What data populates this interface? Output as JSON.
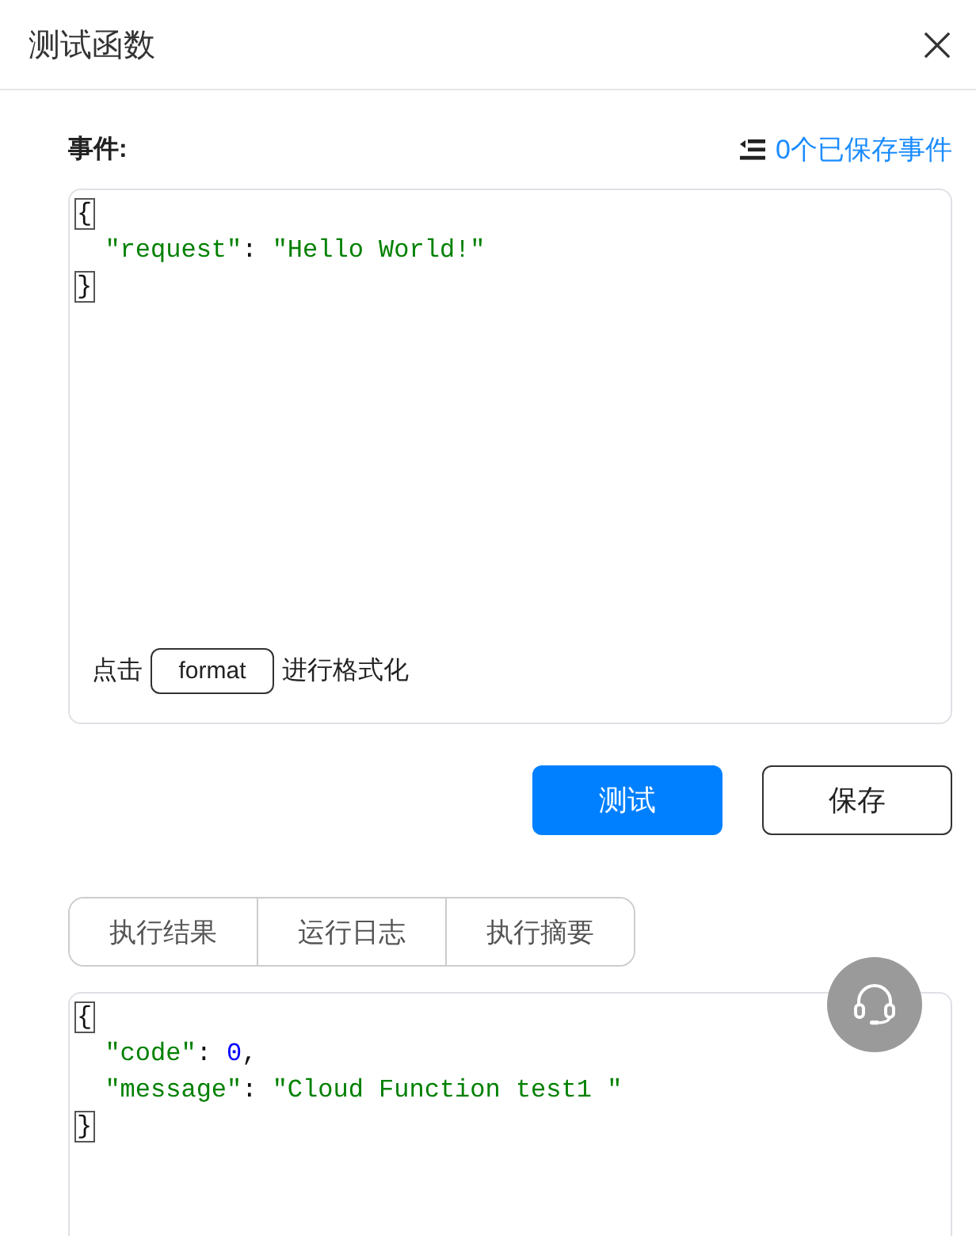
{
  "dialog": {
    "title": "测试函数"
  },
  "event": {
    "label": "事件:",
    "saved_events_link": "0个已保存事件",
    "lines": [
      {
        "tokens": [
          {
            "kind": "bracket",
            "text": "{"
          }
        ],
        "children": [
          {
            "tokens": [
              {
                "kind": "string",
                "text": "\"request\""
              },
              {
                "kind": "punct",
                "text": ": "
              },
              {
                "kind": "string",
                "text": "\"Hello World!\""
              }
            ]
          }
        ]
      },
      {
        "tokens": [
          {
            "kind": "bracket",
            "text": "}"
          }
        ]
      }
    ],
    "format_hint": {
      "before": "点击",
      "button": "format",
      "after": "进行格式化"
    }
  },
  "actions": [
    {
      "label": "测试",
      "kind": "primary"
    },
    {
      "label": "保存",
      "kind": "default"
    }
  ],
  "result_tabs": [
    {
      "label": "执行结果",
      "selected": false
    },
    {
      "label": "运行日志",
      "selected": false
    },
    {
      "label": "执行摘要",
      "selected": false
    }
  ],
  "result": {
    "lines": [
      {
        "tokens": [
          {
            "kind": "bracket",
            "text": "{"
          }
        ],
        "children": [
          {
            "tokens": [
              {
                "kind": "string",
                "text": "\"code\""
              },
              {
                "kind": "punct",
                "text": ": "
              },
              {
                "kind": "number",
                "text": "0"
              },
              {
                "kind": "punct",
                "text": ","
              }
            ]
          },
          {
            "tokens": [
              {
                "kind": "string",
                "text": "\"message\""
              },
              {
                "kind": "punct",
                "text": ": "
              },
              {
                "kind": "string",
                "text": "\"Cloud Function test1 \""
              }
            ]
          }
        ]
      },
      {
        "tokens": [
          {
            "kind": "bracket",
            "text": "}"
          }
        ]
      }
    ]
  }
}
